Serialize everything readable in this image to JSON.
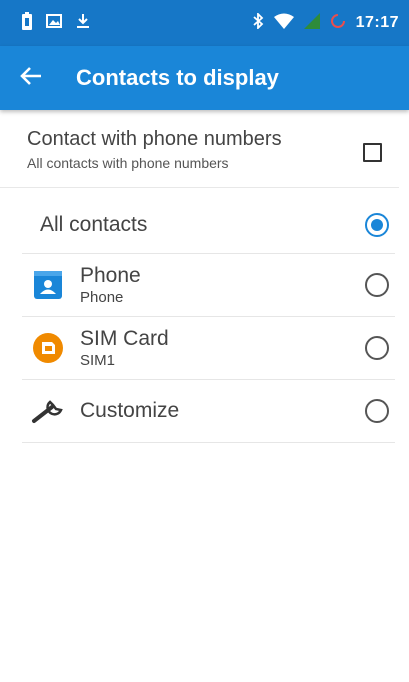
{
  "status_bar": {
    "time": "17:17",
    "icons_left": [
      "battery-saver-icon",
      "image-icon",
      "download-icon"
    ],
    "icons_right": [
      "bluetooth-icon",
      "wifi-icon",
      "signal-icon",
      "sync-icon"
    ]
  },
  "app_bar": {
    "title": "Contacts to display",
    "back_icon": "arrow-back-icon"
  },
  "filter": {
    "title": "Contact with phone numbers",
    "subtitle": "All contacts with phone numbers",
    "checked": false
  },
  "options": [
    {
      "title": "All contacts",
      "subtitle": "",
      "icon": "",
      "selected": true
    },
    {
      "title": "Phone",
      "subtitle": "Phone",
      "icon": "phone-account-icon",
      "selected": false
    },
    {
      "title": "SIM Card",
      "subtitle": "SIM1",
      "icon": "sim-card-icon",
      "selected": false
    },
    {
      "title": "Customize",
      "subtitle": "",
      "icon": "wrench-icon",
      "selected": false
    }
  ],
  "colors": {
    "status_bar": "#1677c7",
    "app_bar": "#1a86d8",
    "accent": "#1a86d8",
    "sim_orange": "#f08a00"
  }
}
